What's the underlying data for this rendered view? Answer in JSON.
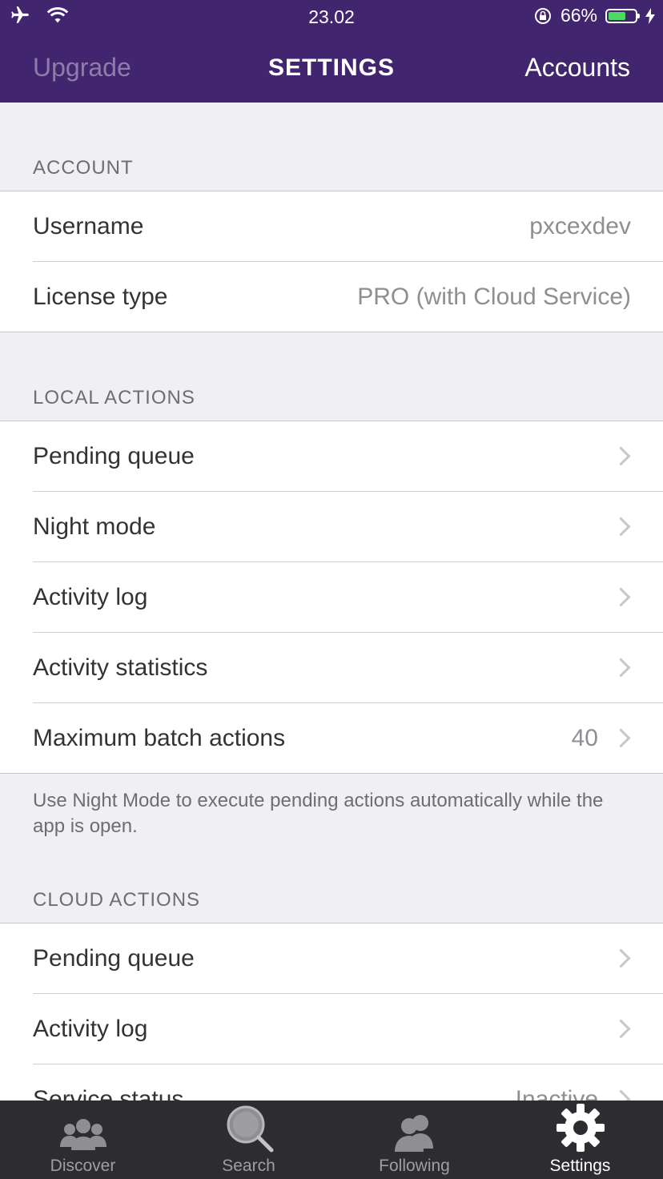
{
  "status_bar": {
    "time": "23.02",
    "battery": "66%",
    "battery_level": 0.66
  },
  "nav": {
    "left": "Upgrade",
    "title": "SETTINGS",
    "right": "Accounts"
  },
  "sections": {
    "account": {
      "header": "ACCOUNT",
      "rows": [
        {
          "label": "Username",
          "value": "pxcexdev"
        },
        {
          "label": "License type",
          "value": "PRO (with Cloud Service)"
        }
      ]
    },
    "local": {
      "header": "LOCAL ACTIONS",
      "rows": [
        {
          "label": "Pending queue"
        },
        {
          "label": "Night mode"
        },
        {
          "label": "Activity log"
        },
        {
          "label": "Activity statistics"
        },
        {
          "label": "Maximum batch actions",
          "value": "40"
        }
      ],
      "footer": "Use Night Mode to execute pending actions automatically while the app is open."
    },
    "cloud": {
      "header": "CLOUD ACTIONS",
      "rows": [
        {
          "label": "Pending queue"
        },
        {
          "label": "Activity log"
        },
        {
          "label": "Service status",
          "value": "Inactive"
        }
      ]
    }
  },
  "tabs": [
    {
      "label": "Discover",
      "icon": "group-icon"
    },
    {
      "label": "Search",
      "icon": "magnifier-icon"
    },
    {
      "label": "Following",
      "icon": "people-icon"
    },
    {
      "label": "Settings",
      "icon": "gear-icon",
      "active": true
    }
  ],
  "colors": {
    "nav_bg": "#42256f",
    "tab_bg": "#2d2c30",
    "battery_fill": "#4cd964"
  }
}
